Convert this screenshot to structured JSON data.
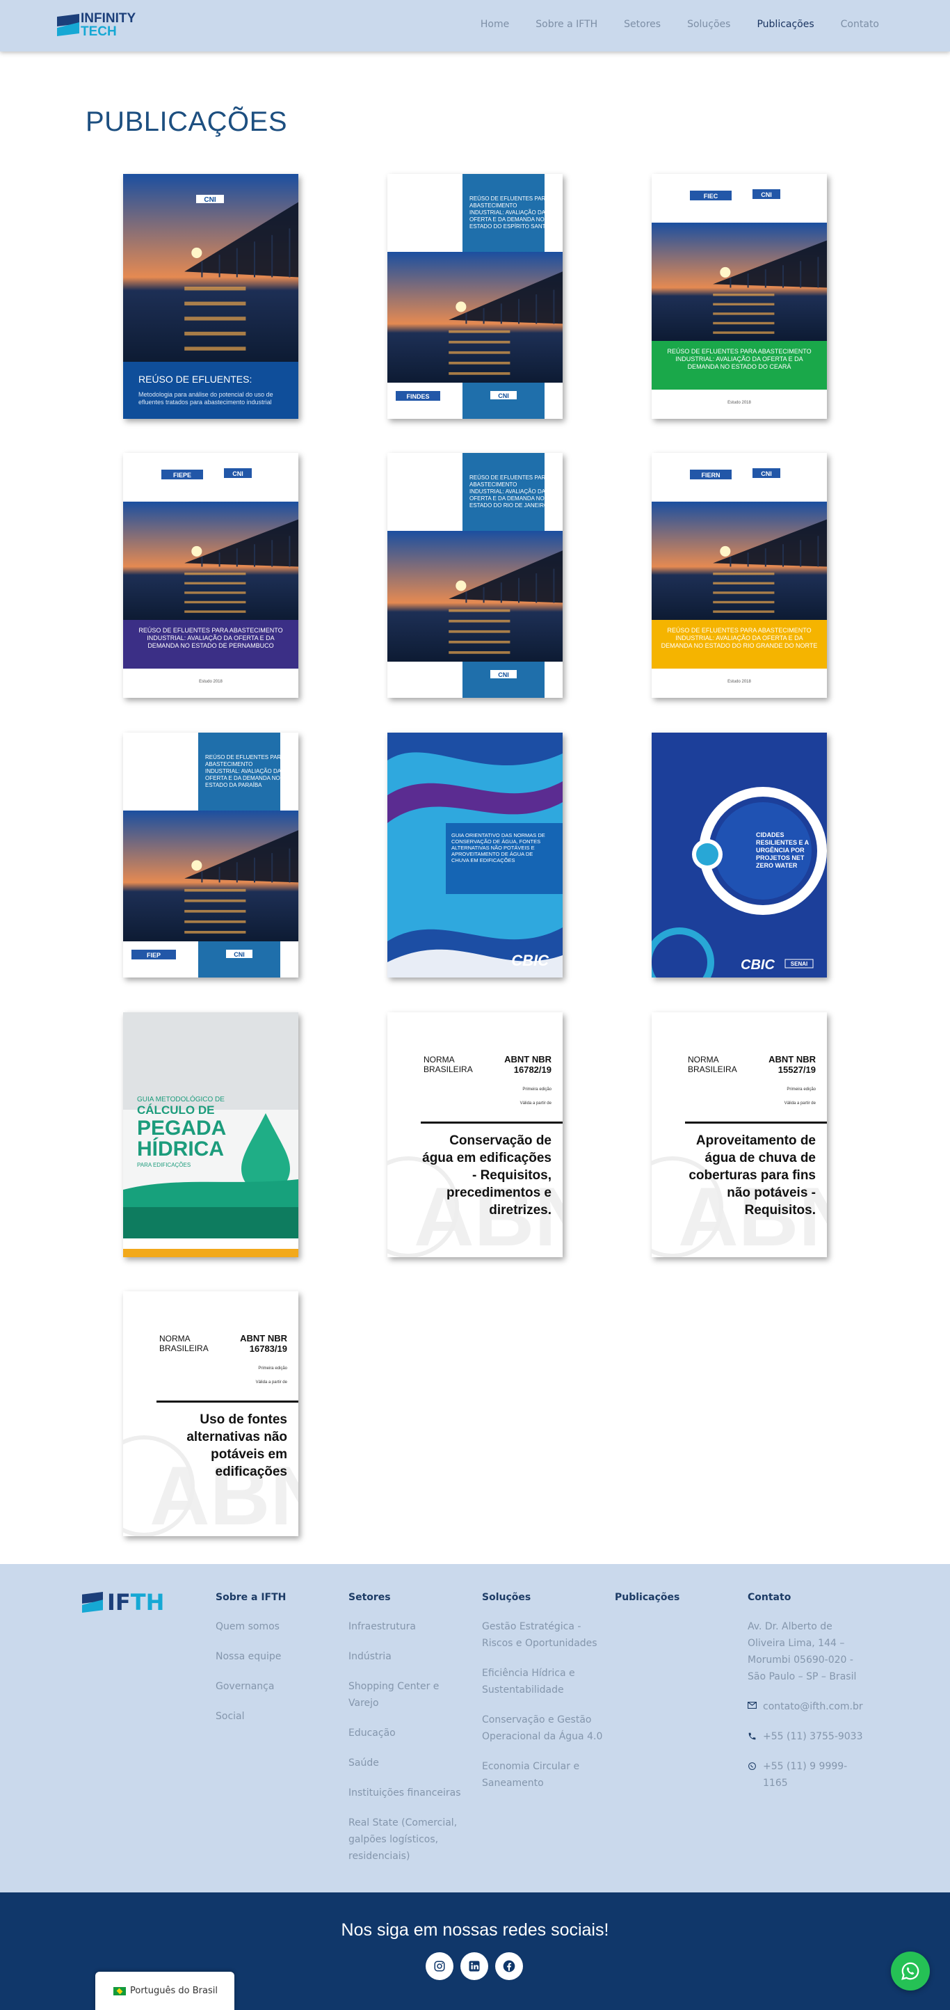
{
  "header": {
    "logo_line1": "INFINITY",
    "logo_line2": "TECH",
    "nav": [
      "Home",
      "Sobre a IFTH",
      "Setores",
      "Soluções",
      "Publicações",
      "Contato"
    ],
    "active_nav": "Publicações"
  },
  "page": {
    "title": "PUBLICAÇÕES"
  },
  "publications": [
    {
      "style": "cni-blue",
      "title_big": "REÚSO DE EFLUENTES:",
      "subtitle": "Metodologia para análise do potencial do uso de efluentes tratados para abastecimento industrial",
      "logo_top": "CNI"
    },
    {
      "style": "blue-box",
      "box_text": "REÚSO DE EFLUENTES PARA ABASTECIMENTO INDUSTRIAL: AVALIAÇÃO DA OFERTA E DA DEMANDA NO ESTADO DO ESPÍRITO SANTO",
      "logo_left": "FINDES",
      "logo_right": "CNI"
    },
    {
      "style": "band",
      "band_color": "#1aa84a",
      "band_text": "REÚSO DE EFLUENTES PARA ABASTECIMENTO INDUSTRIAL: AVALIAÇÃO DA OFERTA E DA DEMANDA NO ESTADO DO CEARÁ",
      "logo_left": "FIEC",
      "logo_right": "CNI",
      "foot": "Estudo 2018"
    },
    {
      "style": "band",
      "band_color": "#3b2f86",
      "band_text": "REÚSO DE EFLUENTES PARA ABASTECIMENTO INDUSTRIAL: AVALIAÇÃO DA OFERTA E DA DEMANDA NO ESTADO DE PERNAMBUCO",
      "logo_left": "FIEPE",
      "logo_right": "CNI",
      "foot": "Estudo 2018"
    },
    {
      "style": "blue-box",
      "box_text": "REÚSO DE EFLUENTES PARA ABASTECIMENTO INDUSTRIAL: AVALIAÇÃO DA OFERTA E DA DEMANDA NO ESTADO DO RIO DE JANEIRO",
      "logo_left": "",
      "logo_right": "CNI"
    },
    {
      "style": "band",
      "band_color": "#f5b400",
      "band_text": "REÚSO DE EFLUENTES PARA ABASTECIMENTO INDUSTRIAL: AVALIAÇÃO DA OFERTA E DA DEMANDA NO ESTADO DO RIO GRANDE DO NORTE",
      "logo_left": "FIERN",
      "logo_right": "CNI",
      "foot": "Estudo 2018"
    },
    {
      "style": "blue-box",
      "box_text": "REÚSO DE EFLUENTES PARA ABASTECIMENTO INDUSTRIAL: AVALIAÇÃO DA OFERTA E DA DEMANDA NO ESTADO DA PARAÍBA",
      "logo_left": "FIEP",
      "logo_right": "CNI"
    },
    {
      "style": "cbic-waves",
      "box_text": "GUIA ORIENTATIVO DAS NORMAS DE CONSERVAÇÃO DE ÁGUA, FONTES ALTERNATIVAS NÃO POTÁVEIS E APROVEITAMENTO DE ÁGUA DE CHUVA EM EDIFICAÇÕES",
      "logo": "CBIC"
    },
    {
      "style": "cbic-circle",
      "circle_text": "CIDADES RESILIENTES E A URGÊNCIA POR PROJETOS NET ZERO WATER",
      "logo": "CBIC",
      "logo2": "SENAI"
    },
    {
      "style": "pegada",
      "line1": "GUIA METODOLÓGICO DE",
      "line2": "CÁLCULO DE",
      "line3": "PEGADA",
      "line4": "HÍDRICA",
      "line5": "PARA EDIFICAÇÕES"
    },
    {
      "style": "abnt",
      "left": [
        "NORMA",
        "BRASILEIRA"
      ],
      "code": [
        "ABNT NBR",
        "16782/19"
      ],
      "small1": "Primeira edição",
      "small2": "Válida a partir de",
      "title": [
        "Conservação de",
        "água em edificações",
        "- Requisitos,",
        "precedimentos e",
        "diretrizes."
      ]
    },
    {
      "style": "abnt",
      "left": [
        "NORMA",
        "BRASILEIRA"
      ],
      "code": [
        "ABNT NBR",
        "15527/19"
      ],
      "small1": "Primeira edição",
      "small2": "Válida a partir de",
      "title": [
        "Aproveitamento de",
        "água de chuva de",
        "coberturas para fins",
        "não potáveis -",
        "Requisitos."
      ]
    },
    {
      "style": "abnt",
      "left": [
        "NORMA",
        "BRASILEIRA"
      ],
      "code": [
        "ABNT NBR",
        "16783/19"
      ],
      "small1": "Primeira edição",
      "small2": "Válida a partir de",
      "title": [
        "Uso de fontes",
        "alternativas não",
        "potáveis em",
        "edificações"
      ]
    }
  ],
  "footer": {
    "logo_a": "IF",
    "logo_b": "TH",
    "cols": [
      {
        "title": "Sobre a IFTH",
        "links": [
          "Quem somos",
          "Nossa equipe",
          "Governança",
          "Social"
        ]
      },
      {
        "title": "Setores",
        "links": [
          "Infraestrutura",
          "Indústria",
          "Shopping Center e Varejo",
          "Educação",
          "Saúde",
          "Instituições financeiras",
          "Real State (Comercial, galpões logísticos, residenciais)"
        ]
      },
      {
        "title": "Soluções",
        "links": [
          "Gestão Estratégica - Riscos e Oportunidades",
          "Eficiência Hídrica e Sustentabilidade",
          "Conservação e Gestão Operacional da Água 4.0",
          "Economia Circular e Saneamento"
        ]
      },
      {
        "title": "Publicações",
        "links": []
      }
    ],
    "contact": {
      "title": "Contato",
      "address": "Av. Dr. Alberto de Oliveira Lima, 144 – Morumbi 05690-020 - São Paulo – SP – Brasil",
      "email": "contato@ifth.com.br",
      "phone": "+55 (11) 3755-9033",
      "whatsapp": "+55 (11) 9 9999-1165"
    }
  },
  "social": {
    "title": "Nos siga em nossas redes sociais!",
    "icons": [
      "instagram-icon",
      "linkedin-icon",
      "facebook-icon"
    ]
  },
  "language": {
    "label": "Português do Brasil"
  },
  "colors": {
    "header_bg": "#cad9ec",
    "title": "#1d4f80",
    "social_bg": "#10376a",
    "whatsapp": "#25c155"
  }
}
